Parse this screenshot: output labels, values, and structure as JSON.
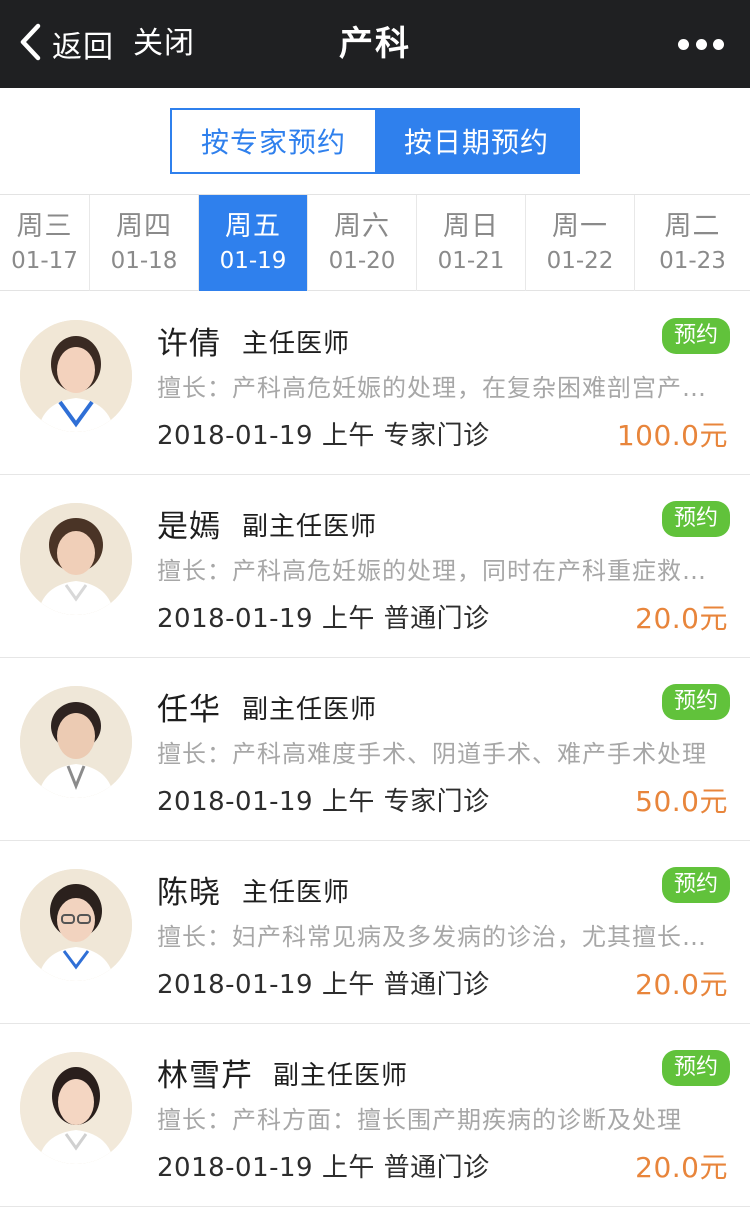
{
  "nav": {
    "back_label": "返回",
    "close_label": "关闭",
    "title": "产科",
    "more_icon": "more-dots-icon"
  },
  "segment": {
    "by_expert": "按专家预约",
    "by_date": "按日期预约",
    "active": "by_date"
  },
  "dates": [
    {
      "weekday": "周三",
      "date": "01-17"
    },
    {
      "weekday": "周四",
      "date": "01-18"
    },
    {
      "weekday": "周五",
      "date": "01-19"
    },
    {
      "weekday": "周六",
      "date": "01-20"
    },
    {
      "weekday": "周日",
      "date": "01-21"
    },
    {
      "weekday": "周一",
      "date": "01-22"
    },
    {
      "weekday": "周二",
      "date": "01-23"
    }
  ],
  "selected_date_index": 2,
  "book_label": "预约",
  "doctors": [
    {
      "name": "许倩",
      "title": "主任医师",
      "specialty": "擅长：产科高危妊娠的处理，在复杂困难剖宫产手术方面经验丰富",
      "slot": "2018-01-19 上午 专家门诊",
      "price": "100.0元"
    },
    {
      "name": "是嫣",
      "title": "副主任医师",
      "specialty": "擅长：产科高危妊娠的处理，同时在产科重症救治方面经验丰富",
      "slot": "2018-01-19 上午 普通门诊",
      "price": "20.0元"
    },
    {
      "name": "任华",
      "title": "副主任医师",
      "specialty": "擅长：产科高难度手术、阴道手术、难产手术处理",
      "slot": "2018-01-19 上午 专家门诊",
      "price": "50.0元"
    },
    {
      "name": "陈晓",
      "title": "主任医师",
      "specialty": "擅长：妇产科常见病及多发病的诊治，尤其擅长高危妊娠管理",
      "slot": "2018-01-19 上午 普通门诊",
      "price": "20.0元"
    },
    {
      "name": "林雪芹",
      "title": "副主任医师",
      "specialty": "擅长：产科方面：擅长围产期疾病的诊断及处理",
      "slot": "2018-01-19 上午 普通门诊",
      "price": "20.0元"
    }
  ],
  "colors": {
    "nav_bg": "#1f2022",
    "accent": "#2f80ed",
    "badge": "#61c23b",
    "price": "#e8853b",
    "muted": "#a7a7a7"
  }
}
